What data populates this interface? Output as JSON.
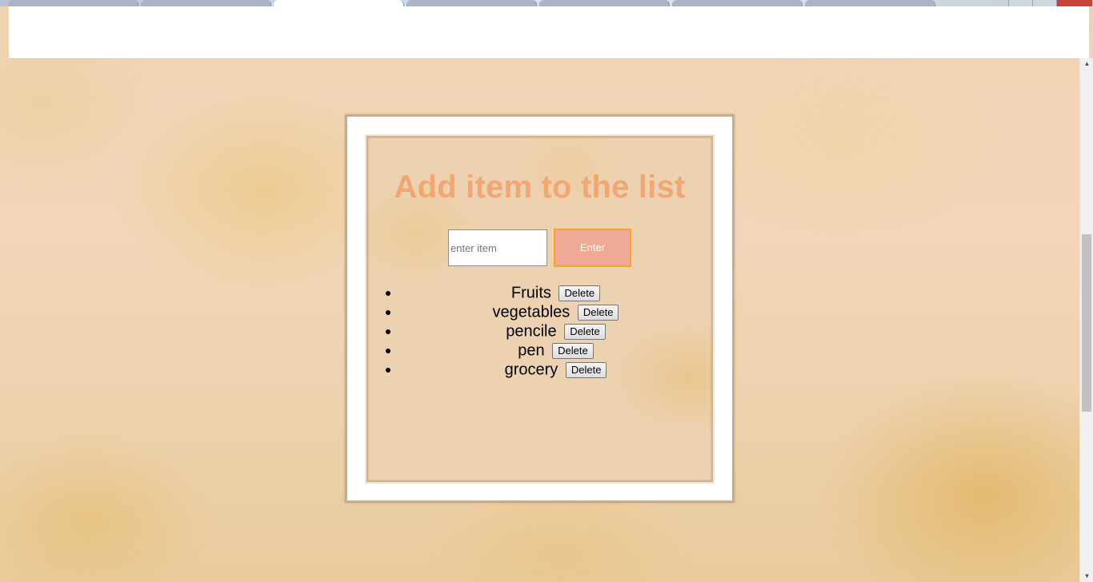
{
  "page": {
    "title": "Add item to the list"
  },
  "form": {
    "input_value": "",
    "input_placeholder": "enter item",
    "enter_label": "Enter"
  },
  "items": [
    {
      "label": "Fruits",
      "delete_label": "Delete"
    },
    {
      "label": "vegetables",
      "delete_label": "Delete"
    },
    {
      "label": "pencile",
      "delete_label": "Delete"
    },
    {
      "label": "pen",
      "delete_label": "Delete"
    },
    {
      "label": "grocery",
      "delete_label": "Delete"
    }
  ],
  "colors": {
    "title": "#f2a772",
    "enter_button_bg": "#eeaa95",
    "enter_button_border": "#f5a524"
  },
  "icons": {
    "scroll_up": "scroll-up-arrow-icon",
    "scroll_down": "scroll-down-arrow-icon"
  }
}
